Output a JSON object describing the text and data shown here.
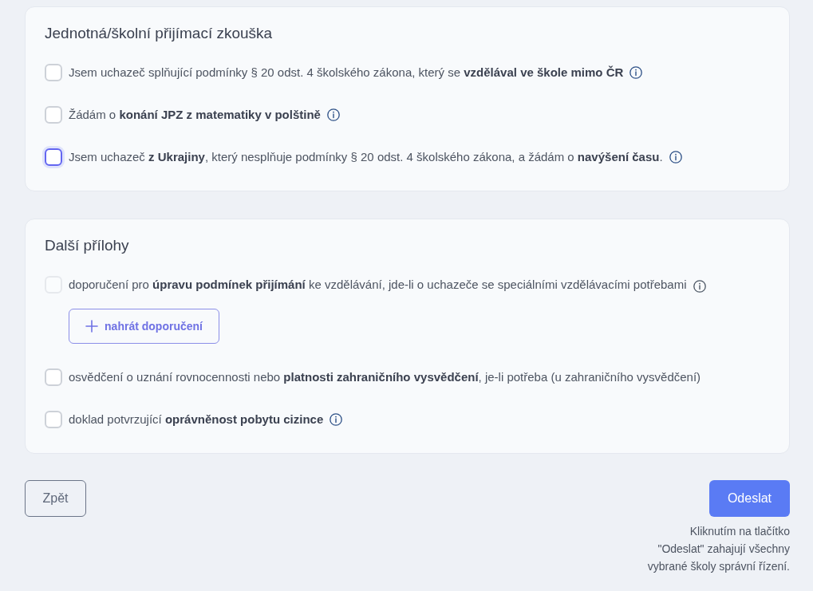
{
  "sections": [
    {
      "title": "Jednotná/školní přijímací zkouška",
      "items": [
        {
          "text": "Jsem uchazeč splňující podmínky § 20 odst. 4 školského zákona, který se **vzdělával ve škole mimo ČR**",
          "checked": false,
          "disabled": false,
          "focused": false,
          "info": true
        },
        {
          "text": "Žádám o **konání JPZ z matematiky v polštině**",
          "checked": false,
          "disabled": false,
          "focused": false,
          "info": true
        },
        {
          "text": "Jsem uchazeč **z Ukrajiny**, který nesplňuje podmínky § 20 odst. 4 školského zákona, a žádám o **navýšení času**.",
          "checked": false,
          "disabled": false,
          "focused": true,
          "info": true
        }
      ]
    },
    {
      "title": "Další přílohy",
      "items": [
        {
          "text": "doporučení pro **úpravu podmínek přijímání** ke vzdělávání, jde-li o uchazeče se speciálními vzdělávacími potřebami",
          "checked": false,
          "disabled": true,
          "focused": false,
          "info": true,
          "upload": {
            "label": "nahrát doporučení"
          }
        },
        {
          "text": "osvědčení o uznání rovnocennosti nebo **platnosti zahraničního vysvědčení**, je-li potřeba (u zahraničního vysvědčení)",
          "checked": false,
          "disabled": false,
          "focused": false,
          "info": false
        },
        {
          "text": "doklad potvrzující **oprávněnost pobytu cizince**",
          "checked": false,
          "disabled": false,
          "focused": false,
          "info": true
        }
      ]
    }
  ],
  "actions": {
    "back": {
      "label": "Zpět"
    },
    "submit": {
      "label": "Odeslat"
    },
    "note": "Kliknutím na tlačítko\n\"Odeslat\" zahajují všechny\nvybrané školy správní řízení."
  }
}
